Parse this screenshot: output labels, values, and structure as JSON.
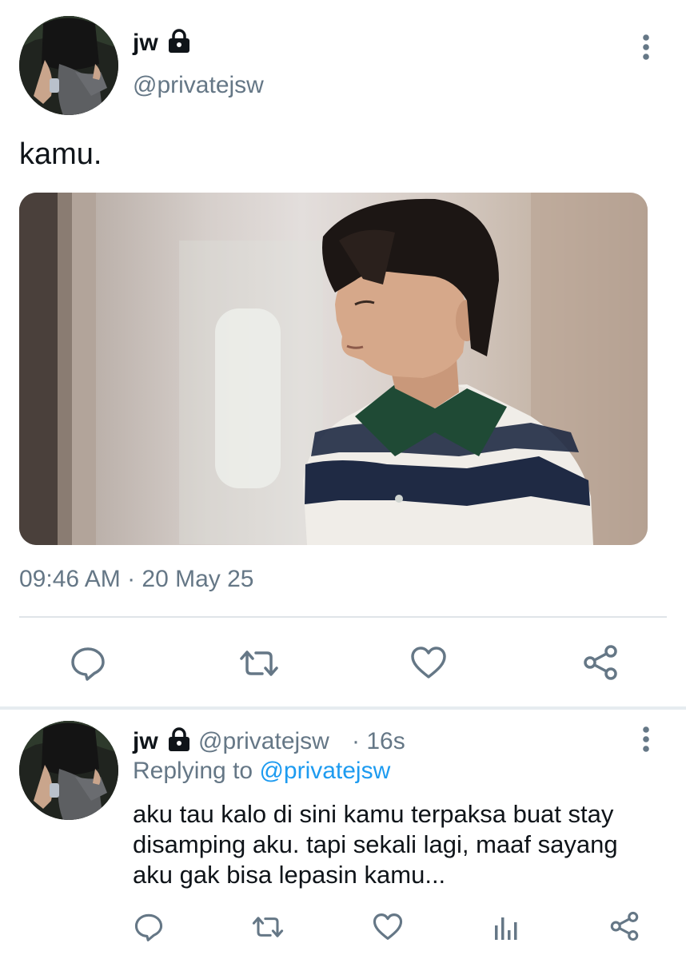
{
  "tweet": {
    "author_name": "jw",
    "author_handle": "@privatejsw",
    "text": "kamu.",
    "timestamp": "09:46 AM · 20 May 25",
    "actions": [
      "reply-icon",
      "retweet-icon",
      "like-icon",
      "share-icon"
    ]
  },
  "reply": {
    "author_name": "jw",
    "author_handle": "@privatejsw",
    "time_ago": "· 16s",
    "replying_prefix": "Replying to",
    "replying_to": "@privatejsw",
    "text_lines": [
      "aku tau kalo di sini kamu terpaksa buat stay",
      "disamping aku. tapi sekali lagi, maaf sayang",
      "aku gak bisa lepasin kamu..."
    ],
    "actions": [
      "reply-icon",
      "retweet-icon",
      "like-icon",
      "analytics-icon",
      "share-icon"
    ]
  },
  "colors": {
    "text": "#0f1419",
    "secondary": "#657786",
    "link": "#1d9bf0",
    "divider": "#dfe4e8"
  }
}
